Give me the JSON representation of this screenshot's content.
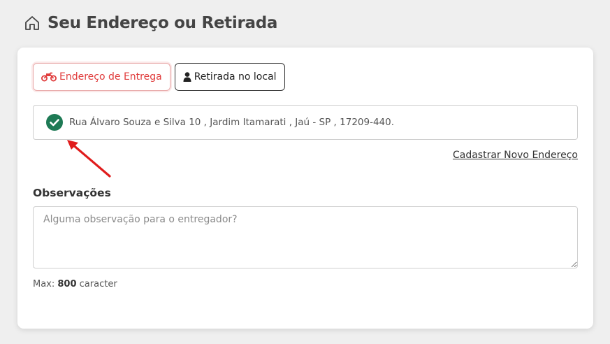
{
  "header": {
    "icon": "home-icon",
    "title": "Seu Endereço ou Retirada"
  },
  "tabs": [
    {
      "label": "Endereço de Entrega",
      "icon": "motorcycle-icon",
      "active": true,
      "color": "#e03c3c"
    },
    {
      "label": "Retirada no local",
      "icon": "user-icon",
      "active": false
    }
  ],
  "address": {
    "icon": "check-circle-icon",
    "icon_color": "#1e8a5c",
    "text": "Rua Álvaro Souza e Silva 10 , Jardim Itamarati , Jaú - SP , 17209-440."
  },
  "new_address_link": "Cadastrar Novo Endereço",
  "annotation": {
    "icon": "red-arrow-icon",
    "color": "#e01c1c"
  },
  "observations": {
    "label": "Observações",
    "placeholder": "Alguma observação para o entregador?",
    "value": "",
    "max_prefix": "Max: ",
    "max_value": "800",
    "max_suffix": " caracter"
  }
}
